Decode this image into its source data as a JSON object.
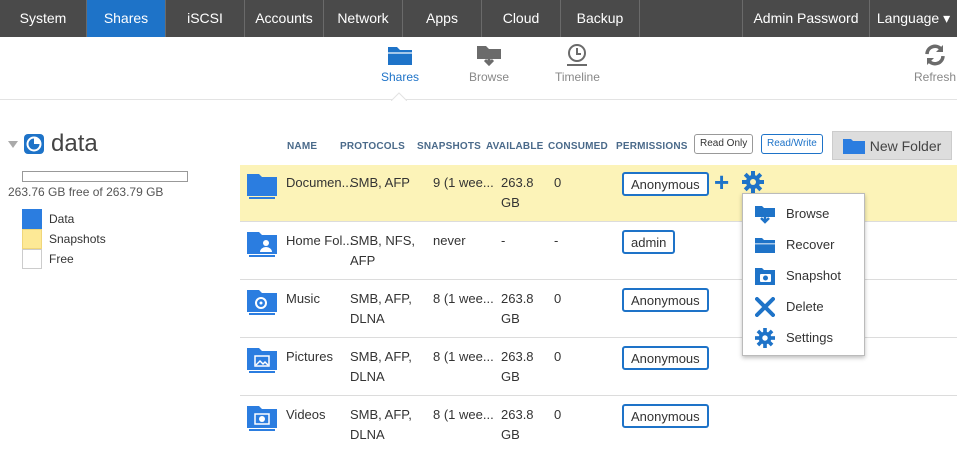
{
  "nav": {
    "tabs": [
      {
        "label": "System"
      },
      {
        "label": "Shares"
      },
      {
        "label": "iSCSI"
      },
      {
        "label": "Accounts"
      },
      {
        "label": "Network"
      },
      {
        "label": "Apps"
      },
      {
        "label": "Cloud"
      },
      {
        "label": "Backup"
      }
    ],
    "admin_password": "Admin Password",
    "language": "Language ▾",
    "active_tab": "Shares",
    "accent_color": "#1e73c8"
  },
  "subnav": {
    "shares": "Shares",
    "browse": "Browse",
    "timeline": "Timeline",
    "refresh": "Refresh"
  },
  "volume": {
    "name": "data",
    "free_text": "263.76 GB free of 263.79 GB",
    "legend": [
      {
        "label": "Data",
        "color": "#2b7de0"
      },
      {
        "label": "Snapshots",
        "color": "#fde996"
      },
      {
        "label": "Free",
        "color": "#ffffff"
      }
    ]
  },
  "table": {
    "headers": {
      "name": "NAME",
      "protocols": "PROTOCOLS",
      "snapshots": "SNAPSHOTS",
      "available": "AVAILABLE",
      "consumed": "CONSUMED",
      "permissions": "PERMISSIONS"
    },
    "read_only": "Read Only",
    "read_write": "Read/Write",
    "new_folder": "New Folder",
    "rows": [
      {
        "name": "Documen...",
        "protocols": "SMB, AFP",
        "snapshots": "9 (1 wee...",
        "available": "263.8 GB",
        "consumed": "0",
        "permission": "Anonymous",
        "icon": "documents-folder-icon"
      },
      {
        "name": "Home Fol...",
        "protocols": "SMB, NFS, AFP",
        "snapshots": "never",
        "available": "-",
        "consumed": "-",
        "permission": "admin",
        "icon": "home-folder-icon"
      },
      {
        "name": "Music",
        "protocols": "SMB, AFP, DLNA",
        "snapshots": "8 (1 wee...",
        "available": "263.8 GB",
        "consumed": "0",
        "permission": "Anonymous",
        "icon": "music-folder-icon"
      },
      {
        "name": "Pictures",
        "protocols": "SMB, AFP, DLNA",
        "snapshots": "8 (1 wee...",
        "available": "263.8 GB",
        "consumed": "0",
        "permission": "Anonymous",
        "icon": "pictures-folder-icon"
      },
      {
        "name": "Videos",
        "protocols": "SMB, AFP, DLNA",
        "snapshots": "8 (1 wee...",
        "available": "263.8 GB",
        "consumed": "0",
        "permission": "Anonymous",
        "icon": "videos-folder-icon"
      }
    ]
  },
  "context_menu": {
    "items": [
      {
        "label": "Browse",
        "icon": "browse-icon"
      },
      {
        "label": "Recover",
        "icon": "recover-icon"
      },
      {
        "label": "Snapshot",
        "icon": "snapshot-icon"
      },
      {
        "label": "Delete",
        "icon": "delete-icon"
      },
      {
        "label": "Settings",
        "icon": "settings-icon"
      }
    ]
  }
}
